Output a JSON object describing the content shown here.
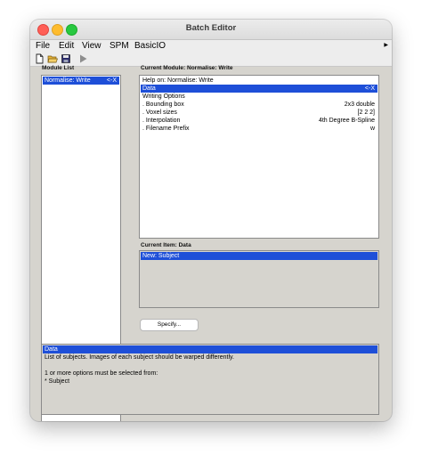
{
  "window": {
    "title": "Batch Editor"
  },
  "menubar": {
    "items": [
      "File",
      "Edit",
      "View",
      "SPM",
      "BasicIO"
    ],
    "overflow_icon": "chevron-right-icon"
  },
  "toolbar": {
    "icons": [
      "new-file-icon",
      "open-folder-icon",
      "save-icon",
      "run-icon"
    ]
  },
  "module_list": {
    "label": "Module List",
    "items": [
      {
        "name": "Normalise: Write",
        "marker": "<-X",
        "selected": true
      }
    ]
  },
  "current_module": {
    "label": "Current Module: Normalise: Write",
    "rows": [
      {
        "key": "Help on: Normalise: Write",
        "value": "",
        "selected": false
      },
      {
        "key": "Data",
        "value": "<-X",
        "selected": true
      },
      {
        "key": "Writing Options",
        "value": "",
        "selected": false
      },
      {
        "key": ". Bounding box",
        "value": "2x3 double",
        "selected": false
      },
      {
        "key": ". Voxel sizes",
        "value": "[2 2 2]",
        "selected": false
      },
      {
        "key": ". Interpolation",
        "value": "4th Degree B-Spline",
        "selected": false
      },
      {
        "key": ". Filename Prefix",
        "value": "w",
        "selected": false
      }
    ]
  },
  "current_item": {
    "label": "Current Item: Data",
    "rows": [
      {
        "key": "New: Subject",
        "selected": true
      }
    ]
  },
  "specify_button": {
    "label": "Specify..."
  },
  "help": {
    "lines": [
      "Data",
      "List of subjects. Images of each subject should be warped differently.",
      "",
      "1 or more options must be selected from:",
      "* Subject"
    ]
  },
  "colors": {
    "selection": "#1e4fd8",
    "window_bg": "#d6d4ce"
  }
}
